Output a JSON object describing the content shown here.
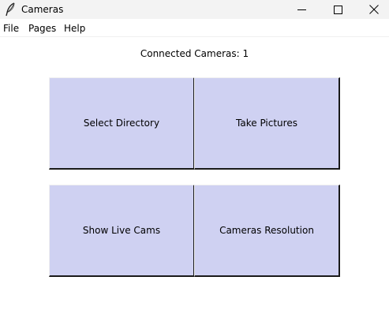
{
  "window": {
    "title": "Cameras",
    "app_icon": "feather-icon",
    "controls": [
      "minimize-icon",
      "maximize-icon",
      "close-icon"
    ]
  },
  "menu": {
    "file": "File",
    "pages": "Pages",
    "help": "Help"
  },
  "status": {
    "connected_text": "Connected Cameras: 1"
  },
  "buttons": {
    "select_directory": "Select Directory",
    "take_pictures": "Take Pictures",
    "show_live_cams": "Show Live Cams",
    "cameras_resolution": "Cameras Resolution"
  },
  "colors": {
    "button_bg": "#cfd1f2",
    "titlebar_bg": "#f3f3f3"
  }
}
